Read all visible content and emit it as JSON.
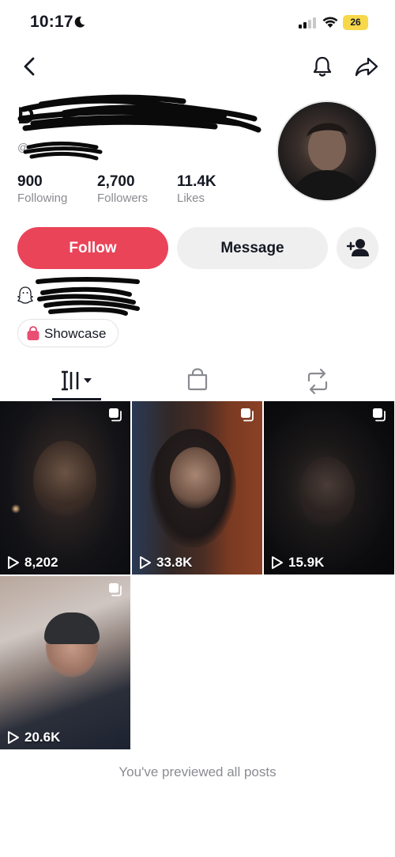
{
  "status_bar": {
    "time": "10:17",
    "battery": "26"
  },
  "nav": {
    "back_icon": "chevron-left-icon",
    "bell_icon": "bell-icon",
    "share_icon": "share-arrow-icon"
  },
  "profile": {
    "display_name": "D",
    "handle": "@",
    "stats": [
      {
        "value": "900",
        "label": "Following"
      },
      {
        "value": "2,700",
        "label": "Followers"
      },
      {
        "value": "11.4K",
        "label": "Likes"
      }
    ]
  },
  "actions": {
    "follow_label": "Follow",
    "message_label": "Message",
    "add_friend_icon": "add-person-icon"
  },
  "bio": {
    "snapchat_icon": "ghost-icon"
  },
  "showcase": {
    "label": "Showcase",
    "icon": "shopping-bag-icon"
  },
  "tabs": [
    {
      "name": "videos",
      "icon": "grid-columns-icon",
      "active": true
    },
    {
      "name": "shop",
      "icon": "shopping-bag-icon",
      "active": false
    },
    {
      "name": "reposts",
      "icon": "repost-icon",
      "active": false
    }
  ],
  "videos": [
    {
      "views": "8,202"
    },
    {
      "views": "33.8K"
    },
    {
      "views": "15.9K"
    },
    {
      "views": "20.6K"
    }
  ],
  "footer": {
    "end_text": "You've previewed all posts"
  },
  "colors": {
    "accent": "#ea4459",
    "muted_text": "#8a8b91",
    "battery": "#f7d84a"
  }
}
